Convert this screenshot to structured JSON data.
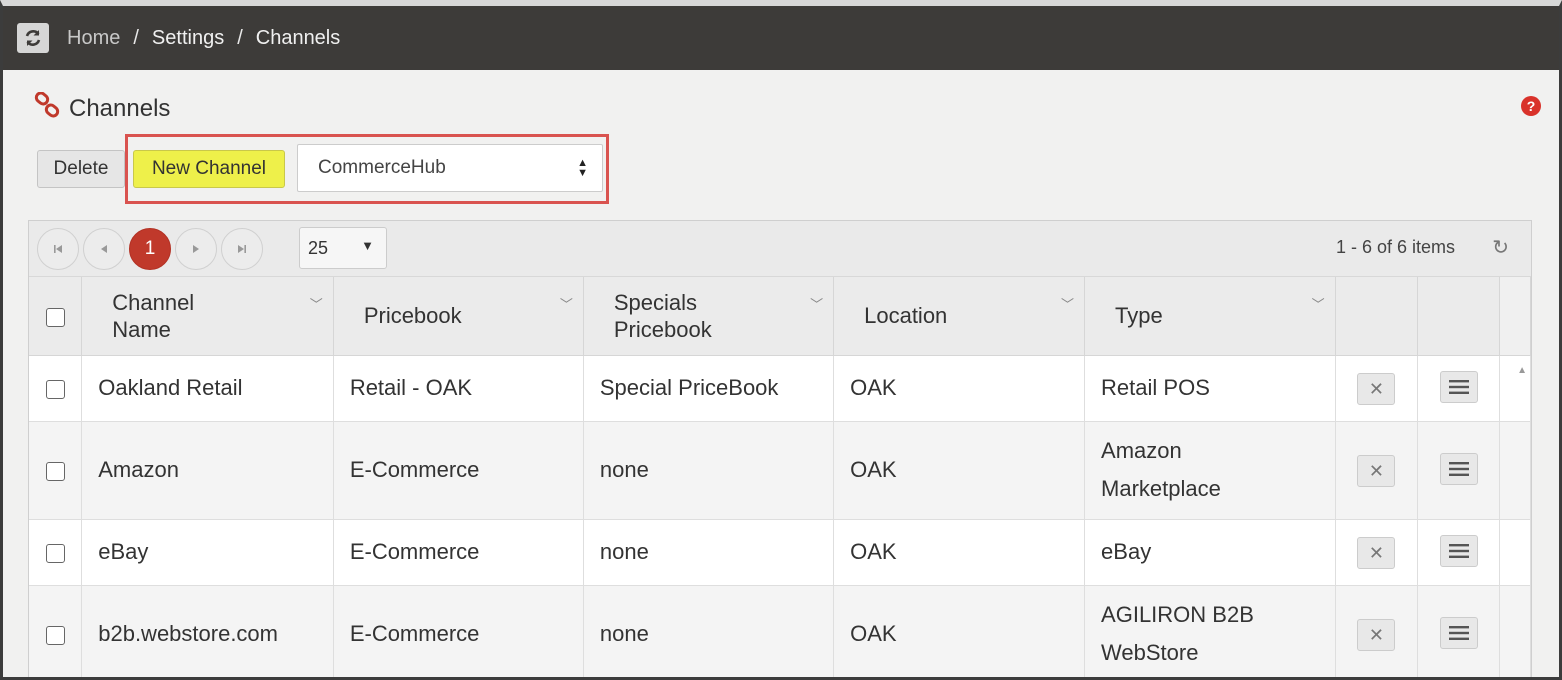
{
  "breadcrumb": {
    "home": "Home",
    "settings": "Settings",
    "current": "Channels",
    "sep": "/"
  },
  "page": {
    "title": "Channels",
    "help_icon": "?"
  },
  "toolbar": {
    "delete_label": "Delete",
    "new_channel_label": "New Channel",
    "channel_type_selected": "CommerceHub"
  },
  "pager": {
    "first_icon": "⏮",
    "prev_icon": "◀",
    "current_page": "1",
    "next_icon": "▶",
    "last_icon": "⏭",
    "page_size": "25",
    "items_info": "1 - 6 of 6 items",
    "refresh_icon": "↻"
  },
  "table": {
    "columns": [
      "Channel Name",
      "Pricebook",
      "Specials Pricebook",
      "Location",
      "Type"
    ],
    "rows": [
      {
        "name": "Oakland Retail",
        "pricebook": "Retail - OAK",
        "specials": "Special PriceBook",
        "location": "OAK",
        "type": "Retail POS"
      },
      {
        "name": "Amazon",
        "pricebook": "E-Commerce",
        "specials": "none",
        "location": "OAK",
        "type": "Amazon Marketplace"
      },
      {
        "name": "eBay",
        "pricebook": "E-Commerce",
        "specials": "none",
        "location": "OAK",
        "type": "eBay"
      },
      {
        "name": "b2b.webstore.com",
        "pricebook": "E-Commerce",
        "specials": "none",
        "location": "OAK",
        "type": "AGILIRON B2B WebStore"
      }
    ],
    "delete_icon": "✕"
  },
  "colors": {
    "accent_red": "#c0392b",
    "highlight_yellow": "#eef04a",
    "topbar": "#3d3b39"
  }
}
